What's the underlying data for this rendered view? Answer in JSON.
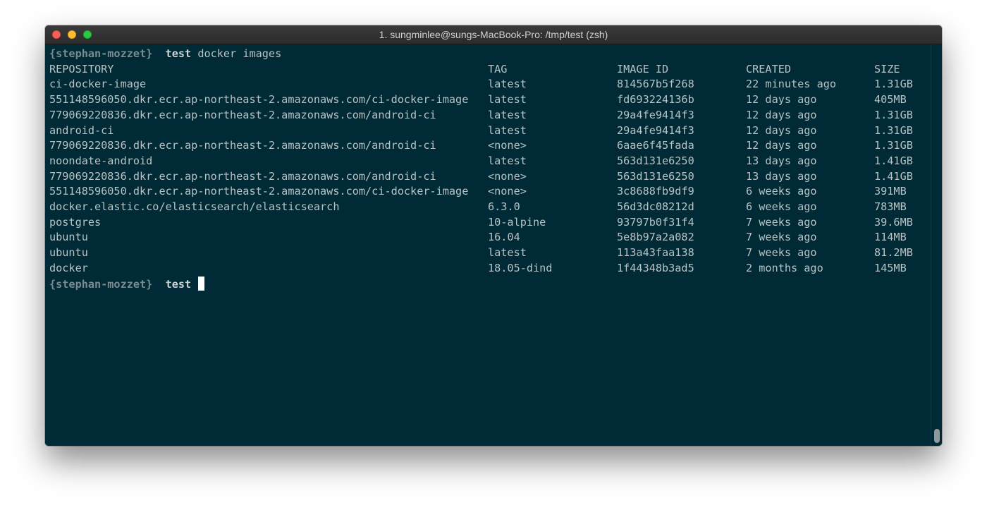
{
  "window": {
    "title": "1. sungminlee@sungs-MacBook-Pro: /tmp/test (zsh)"
  },
  "prompt": {
    "user": "{stephan-mozzet}",
    "dir": "test",
    "command": "docker images"
  },
  "table": {
    "headers": {
      "repository": "REPOSITORY",
      "tag": "TAG",
      "image_id": "IMAGE ID",
      "created": "CREATED",
      "size": "SIZE"
    },
    "rows": [
      {
        "repository": "ci-docker-image",
        "tag": "latest",
        "image_id": "814567b5f268",
        "created": "22 minutes ago",
        "size": "1.31GB"
      },
      {
        "repository": "551148596050.dkr.ecr.ap-northeast-2.amazonaws.com/ci-docker-image",
        "tag": "latest",
        "image_id": "fd693224136b",
        "created": "12 days ago",
        "size": "405MB"
      },
      {
        "repository": "779069220836.dkr.ecr.ap-northeast-2.amazonaws.com/android-ci",
        "tag": "latest",
        "image_id": "29a4fe9414f3",
        "created": "12 days ago",
        "size": "1.31GB"
      },
      {
        "repository": "android-ci",
        "tag": "latest",
        "image_id": "29a4fe9414f3",
        "created": "12 days ago",
        "size": "1.31GB"
      },
      {
        "repository": "779069220836.dkr.ecr.ap-northeast-2.amazonaws.com/android-ci",
        "tag": "<none>",
        "image_id": "6aae6f45fada",
        "created": "12 days ago",
        "size": "1.31GB"
      },
      {
        "repository": "noondate-android",
        "tag": "latest",
        "image_id": "563d131e6250",
        "created": "13 days ago",
        "size": "1.41GB"
      },
      {
        "repository": "779069220836.dkr.ecr.ap-northeast-2.amazonaws.com/android-ci",
        "tag": "<none>",
        "image_id": "563d131e6250",
        "created": "13 days ago",
        "size": "1.41GB"
      },
      {
        "repository": "551148596050.dkr.ecr.ap-northeast-2.amazonaws.com/ci-docker-image",
        "tag": "<none>",
        "image_id": "3c8688fb9df9",
        "created": "6 weeks ago",
        "size": "391MB"
      },
      {
        "repository": "docker.elastic.co/elasticsearch/elasticsearch",
        "tag": "6.3.0",
        "image_id": "56d3dc08212d",
        "created": "6 weeks ago",
        "size": "783MB"
      },
      {
        "repository": "postgres",
        "tag": "10-alpine",
        "image_id": "93797b0f31f4",
        "created": "7 weeks ago",
        "size": "39.6MB"
      },
      {
        "repository": "ubuntu",
        "tag": "16.04",
        "image_id": "5e8b97a2a082",
        "created": "7 weeks ago",
        "size": "114MB"
      },
      {
        "repository": "ubuntu",
        "tag": "latest",
        "image_id": "113a43faa138",
        "created": "7 weeks ago",
        "size": "81.2MB"
      },
      {
        "repository": "docker",
        "tag": "18.05-dind",
        "image_id": "1f44348b3ad5",
        "created": "2 months ago",
        "size": "145MB"
      }
    ]
  },
  "colors": {
    "terminal_background": "#002b36",
    "text": "#b7c3c5",
    "prompt_user": "#7a8a8e",
    "cursor": "#ffffff"
  }
}
